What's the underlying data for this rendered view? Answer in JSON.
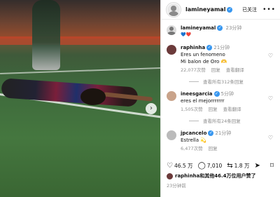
{
  "post": {
    "username": "lamineyamal",
    "follow_label": "已关注",
    "more_icon": "more-icon"
  },
  "caption": {
    "username": "lamineyamal",
    "text": "💙❤️",
    "time": "23分钟"
  },
  "comments": [
    {
      "username": "raphinha",
      "time": "21分钟",
      "lines": [
        "Eres un fenomeno",
        "Mi balon de Oro 🫶"
      ],
      "likes": "22,077次赞",
      "reply": "回复",
      "translate": "查看翻译",
      "replies_label": "查看所有312条回复"
    },
    {
      "username": "ineesgarcia",
      "time": "5分钟",
      "lines": [
        "eres el mejorrrrrrr"
      ],
      "likes": "1,505次赞",
      "reply": "回复",
      "translate": "查看翻译",
      "replies_label": "查看所有24条回复"
    },
    {
      "username": "jpcancelo",
      "time": "21分钟",
      "lines": [
        "Estrella 💫"
      ],
      "likes": "6,477次赞",
      "reply": "回复",
      "translate": "",
      "replies_label": ""
    }
  ],
  "actions": {
    "likes": "46.5 万",
    "comments": "7,010",
    "shares": "1.8 万"
  },
  "liked_by": "raphinha和其他46.4万位用户赞了",
  "posted_ago": "23分钟前"
}
